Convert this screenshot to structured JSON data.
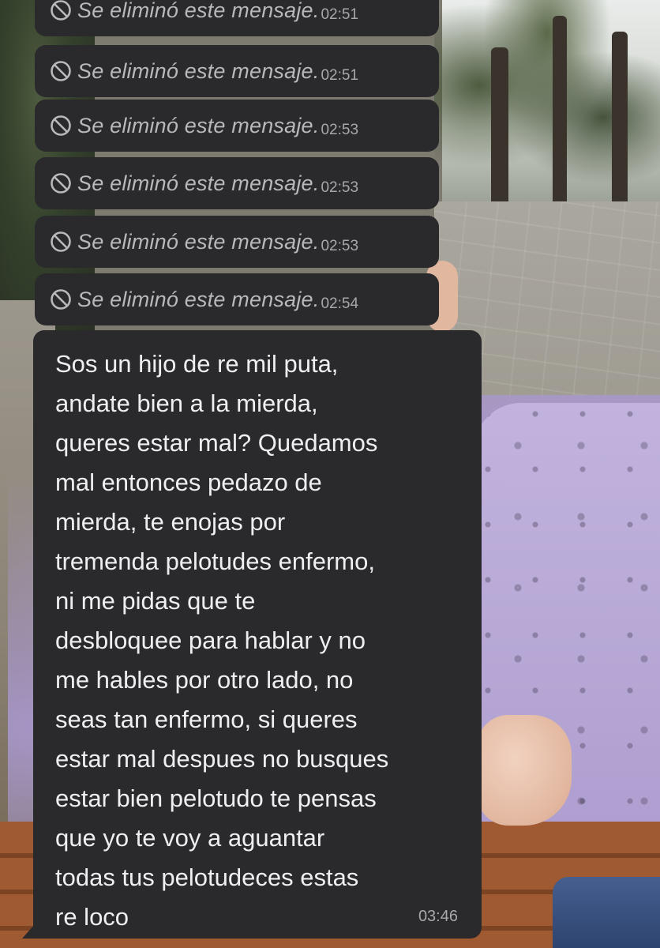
{
  "deleted_messages": [
    {
      "text": "Se eliminó este mensaje.",
      "time": "02:51"
    },
    {
      "text": "Se eliminó este mensaje.",
      "time": "02:51"
    },
    {
      "text": "Se eliminó este mensaje.",
      "time": "02:53"
    },
    {
      "text": "Se eliminó este mensaje.",
      "time": "02:53"
    },
    {
      "text": "Se eliminó este mensaje.",
      "time": "02:53"
    },
    {
      "text": "Se eliminó este mensaje.",
      "time": "02:54"
    }
  ],
  "deleted_icon": "ban-icon",
  "main_message": {
    "lines": [
      "Sos un hijo de re mil puta,",
      "andate bien a la mierda,",
      "queres estar mal? Quedamos",
      "mal entonces pedazo de",
      "mierda, te enojas por",
      "tremenda pelotudes enfermo,",
      "ni me pidas que te",
      "desbloquee para hablar y no",
      "me hables por otro lado, no",
      "seas tan enfermo, si queres",
      "estar mal despues no busques",
      "estar bien pelotudo te pensas",
      "que yo te voy a aguantar",
      "todas tus pelotudeces estas",
      "re loco"
    ],
    "time": "03:46"
  },
  "colors": {
    "bubble": "#2a2a2d",
    "text": "#efeff1",
    "muted_text": "#b9b9bd"
  }
}
